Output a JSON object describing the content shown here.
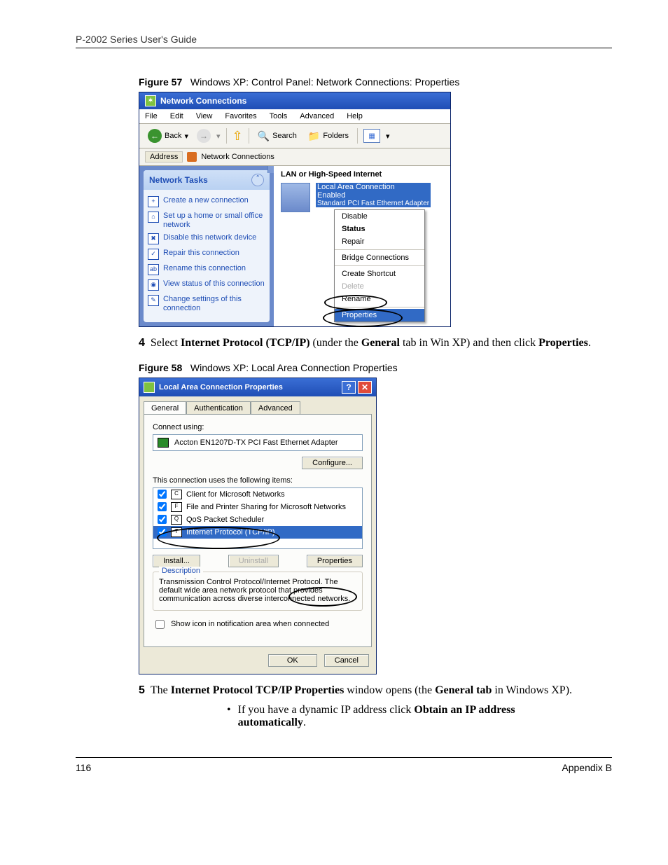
{
  "header": {
    "running_head": "P-2002 Series User's Guide"
  },
  "figure57": {
    "caption_num": "Figure 57",
    "caption_text": "Windows XP: Control Panel: Network Connections: Properties",
    "title": "Network Connections",
    "menu": [
      "File",
      "Edit",
      "View",
      "Favorites",
      "Tools",
      "Advanced",
      "Help"
    ],
    "toolbar": {
      "back": "Back",
      "search": "Search",
      "folders": "Folders"
    },
    "address_label": "Address",
    "address_value": "Network Connections",
    "tasks_head": "Network Tasks",
    "tasks": [
      "Create a new connection",
      "Set up a home or small office network",
      "Disable this network device",
      "Repair this connection",
      "Rename this connection",
      "View status of this connection",
      "Change settings of this connection"
    ],
    "group_head": "LAN or High-Speed Internet",
    "conn_name": "Local Area Connection",
    "conn_state": "Enabled",
    "conn_device": "Standard PCI Fast Ethernet Adapter",
    "ctx": {
      "disable": "Disable",
      "status": "Status",
      "repair": "Repair",
      "bridge": "Bridge Connections",
      "shortcut": "Create Shortcut",
      "delete": "Delete",
      "rename": "Rename",
      "properties": "Properties"
    }
  },
  "step4": {
    "num": "4",
    "pre": "Select ",
    "b1": "Internet Protocol (TCP/IP)",
    "mid": " (under the ",
    "b2": "General",
    "mid2": " tab in Win XP) and then click ",
    "b3": "Properties",
    "post": "."
  },
  "figure58": {
    "caption_num": "Figure 58",
    "caption_text": "Windows XP: Local Area Connection Properties",
    "title": "Local Area Connection Properties",
    "tabs": [
      "General",
      "Authentication",
      "Advanced"
    ],
    "connect_using_label": "Connect using:",
    "adapter": "Accton EN1207D-TX PCI Fast Ethernet Adapter",
    "configure": "Configure...",
    "uses_label": "This connection uses the following items:",
    "items": [
      "Client for Microsoft Networks",
      "File and Printer Sharing for Microsoft Networks",
      "QoS Packet Scheduler",
      "Internet Protocol (TCP/IP)"
    ],
    "install": "Install...",
    "uninstall": "Uninstall",
    "properties": "Properties",
    "desc_legend": "Description",
    "desc_text": "Transmission Control Protocol/Internet Protocol. The default wide area network protocol that provides communication across diverse interconnected networks.",
    "notify": "Show icon in notification area when connected",
    "ok": "OK",
    "cancel": "Cancel"
  },
  "step5": {
    "num": "5",
    "pre": "The ",
    "b1": "Internet Protocol TCP/IP Properties",
    "mid": " window opens (the ",
    "b2": "General tab",
    "post": " in Windows XP)."
  },
  "bullet1": {
    "pre": "If you have a dynamic IP address click ",
    "b1": "Obtain an IP address automatically",
    "post": "."
  },
  "footer": {
    "page": "116",
    "section": "Appendix B"
  }
}
